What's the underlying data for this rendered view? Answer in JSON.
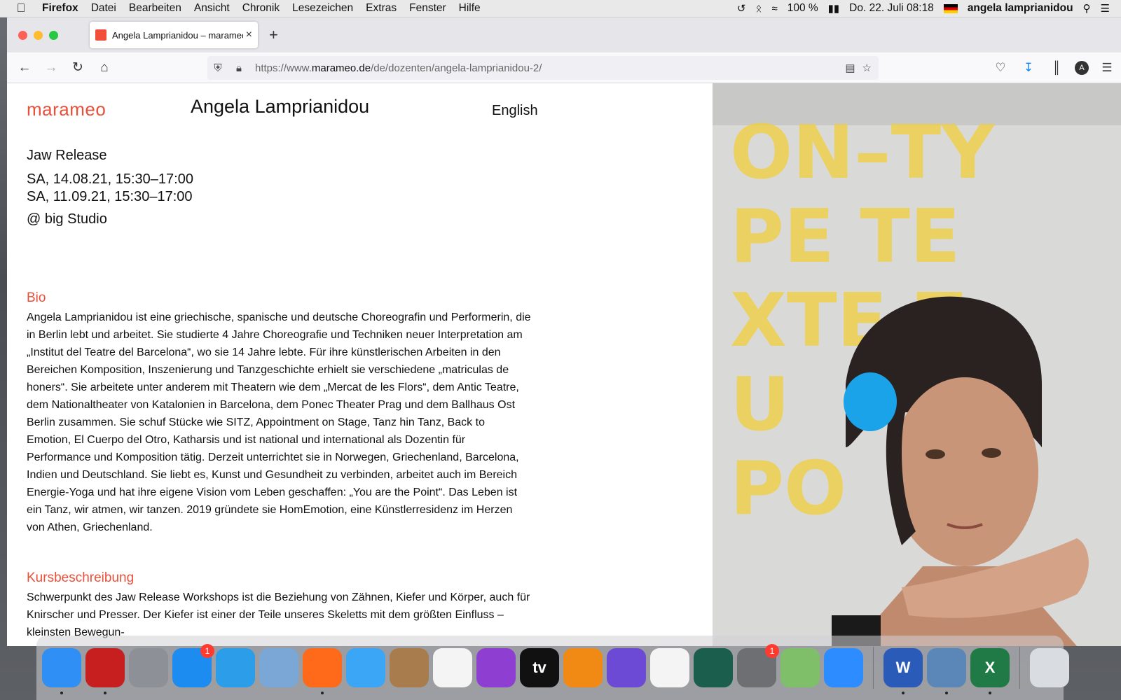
{
  "menubar": {
    "apple": "",
    "app_name": "Firefox",
    "items": [
      "Datei",
      "Bearbeiten",
      "Ansicht",
      "Chronik",
      "Lesezeichen",
      "Extras",
      "Fenster",
      "Hilfe"
    ],
    "battery": "100 %",
    "datetime": "Do. 22. Juli 08:18",
    "user": "angela lamprianidou"
  },
  "browser": {
    "tab_title": "Angela Lamprianidou – marameo",
    "url_prefix": "https://www.",
    "url_domain": "marameo.de",
    "url_path": "/de/dozenten/angela-lamprianidou-2/"
  },
  "page": {
    "logo": "marameo",
    "title": "Angela Lamprianidou",
    "language_link": "English",
    "event": {
      "title": "Jaw Release",
      "dates": [
        "SA, 14.08.21, 15:30–17:00",
        "SA, 11.09.21, 15:30–17:00"
      ],
      "location": "@ big Studio"
    },
    "bio_heading": "Bio",
    "bio_text": "Angela Lamprianidou ist eine griechische, spanische und deutsche Choreografin und Performerin, die in Berlin lebt und arbeitet. Sie studierte 4 Jahre Choreografie und Techniken neuer Interpretation am „Institut del Teatre del Barcelona“, wo sie 14 Jahre lebte. Für ihre künstlerischen Arbeiten in den Bereichen Komposition, Inszenierung und Tanzgeschichte erhielt sie verschiedene „matriculas de honers“. Sie arbeitete unter anderem mit Theatern wie dem „Mercat de les Flors“, dem Antic Teatre, dem Nationaltheater von Katalonien in Barcelona, dem Ponec Theater Prag und dem Ballhaus Ost Berlin zusammen. Sie schuf Stücke wie SITZ, Appointment on Stage, Tanz hin Tanz, Back to Emotion, El Cuerpo del Otro, Katharsis und ist national und international als Dozentin für Performance und Komposition tätig. Derzeit unterrichtet sie in Norwegen, Griechenland, Barcelona, Indien und Deutschland. Sie liebt es, Kunst und Gesundheit zu verbinden, arbeitet auch im Bereich Energie-Yoga und hat ihre eigene Vision vom Leben geschaffen: „You are the Point“. Das Leben ist ein Tanz, wir atmen, wir tanzen. 2019 gründete sie HomEmotion, eine Künstlerresidenz im Herzen von Athen, Griechenland.",
    "course_heading": "Kursbeschreibung",
    "course_text": "Schwerpunkt des Jaw Release Workshops ist die Beziehung von Zähnen, Kiefer und Körper, auch für Knirscher und Presser. Der Kiefer ist einer der Teile unseres Skeletts mit dem größten Einfluss – kleinsten Bewegun-",
    "photo_poster_letters": [
      "ON–TY",
      "PE TE",
      "XTE Z",
      "U",
      "PO"
    ]
  },
  "dock": {
    "items": [
      {
        "name": "finder",
        "label": "",
        "color": "#2f8ff5",
        "badge": "",
        "running": true
      },
      {
        "name": "acrobat",
        "label": "",
        "color": "#c71f1f",
        "badge": "",
        "running": true
      },
      {
        "name": "launchpad",
        "label": "",
        "color": "#8d9096",
        "badge": "",
        "running": false
      },
      {
        "name": "app-store",
        "label": "",
        "color": "#1d8cf0",
        "badge": "1",
        "running": false
      },
      {
        "name": "safari",
        "label": "",
        "color": "#2c9de8",
        "badge": "",
        "running": false
      },
      {
        "name": "preview",
        "label": "",
        "color": "#7aa7d6",
        "badge": "",
        "running": false
      },
      {
        "name": "firefox",
        "label": "",
        "color": "#ff6a1a",
        "badge": "",
        "running": true
      },
      {
        "name": "messages",
        "label": "",
        "color": "#3ba6f6",
        "badge": "",
        "running": false
      },
      {
        "name": "contacts",
        "label": "",
        "color": "#a97c4e",
        "badge": "",
        "running": false
      },
      {
        "name": "music",
        "label": "",
        "color": "#f4f4f4",
        "badge": "",
        "running": false
      },
      {
        "name": "podcasts",
        "label": "",
        "color": "#8e3fd1",
        "badge": "",
        "running": false
      },
      {
        "name": "apple-tv",
        "label": "tv",
        "color": "#111111",
        "badge": "",
        "running": false
      },
      {
        "name": "books",
        "label": "",
        "color": "#f08a14",
        "badge": "",
        "running": false
      },
      {
        "name": "imovie",
        "label": "",
        "color": "#6c4ad6",
        "badge": "",
        "running": false
      },
      {
        "name": "photos",
        "label": "",
        "color": "#f4f4f4",
        "badge": "",
        "running": false
      },
      {
        "name": "time-machine",
        "label": "",
        "color": "#1c5e4d",
        "badge": "",
        "running": false
      },
      {
        "name": "system-preferences",
        "label": "",
        "color": "#6d6f73",
        "badge": "1",
        "running": false
      },
      {
        "name": "maps",
        "label": "",
        "color": "#7fbf6a",
        "badge": "",
        "running": false
      },
      {
        "name": "zoom",
        "label": "",
        "color": "#2d8cff",
        "badge": "",
        "running": false
      },
      {
        "name": "word",
        "label": "W",
        "color": "#2b5bb8",
        "badge": "",
        "running": true
      },
      {
        "name": "image-viewer",
        "label": "",
        "color": "#5a86b8",
        "badge": "",
        "running": true
      },
      {
        "name": "excel",
        "label": "X",
        "color": "#1f7a45",
        "badge": "",
        "running": true
      },
      {
        "name": "trash",
        "label": "",
        "color": "#d9dde2",
        "badge": "",
        "running": false
      }
    ]
  }
}
